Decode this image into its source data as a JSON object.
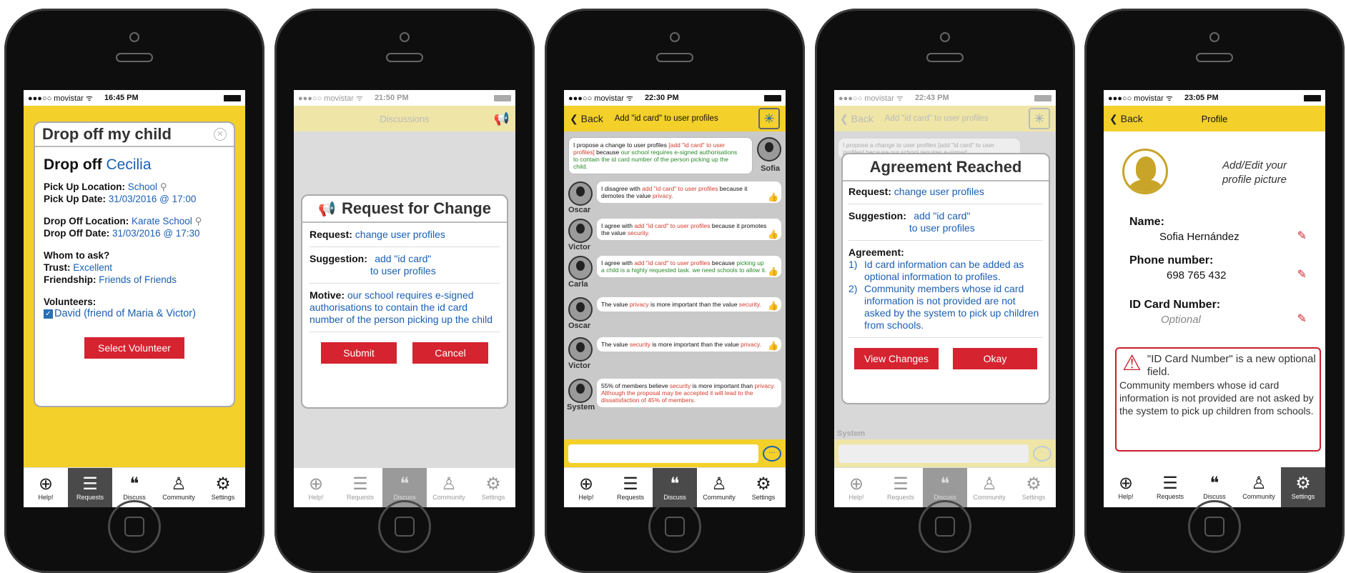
{
  "status": {
    "carrier": "●●●○○ movistar ᯤ",
    "times": [
      "16:45 PM",
      "21:50 PM",
      "22:30 PM",
      "22:43 PM",
      "23:05 PM"
    ]
  },
  "tabs": {
    "help": "Help!",
    "requests": "Requests",
    "discuss": "Discuss",
    "community": "Community",
    "settings": "Settings"
  },
  "screen1": {
    "card_title": "Drop off my child",
    "heading_prefix": "Drop off",
    "heading_name": "Cecilia",
    "pickup_location_label": "Pick Up Location:",
    "pickup_location": "School",
    "pickup_date_label": "Pick Up Date:",
    "pickup_date": "31/03/2016 @ 17:00",
    "dropoff_location_label": "Drop Off Location:",
    "dropoff_location": "Karate School",
    "dropoff_date_label": "Drop Off Date:",
    "dropoff_date": "31/03/2016 @ 17:30",
    "whom_label": "Whom to ask?",
    "trust_label": "Trust:",
    "trust": "Excellent",
    "friendship_label": "Friendship:",
    "friendship": "Friends of Friends",
    "volunteers_label": "Volunteers:",
    "volunteer": "David (friend of  Maria & Victor)",
    "select_button": "Select Volunteer"
  },
  "screen2": {
    "nav_title": "Discussions",
    "card_title": "Request for Change",
    "request_label": "Request:",
    "request": "change user profiles",
    "suggestion_label": "Suggestion:",
    "suggestion_1": "add \"id card\"",
    "suggestion_2": "to user profiles",
    "motive_label": "Motive:",
    "motive": "our school requires e-signed authorisations to contain the id card number of the person picking up the child",
    "submit": "Submit",
    "cancel": "Cancel"
  },
  "screen3": {
    "back": "Back",
    "nav_title": "Add \"id card\" to user profiles",
    "messages": [
      {
        "who": "Sofia",
        "a": "I propose a change to user profiles ",
        "b": "[add \"id card\" to user profiles]",
        "c": " because ",
        "d": "our school requires e-signed authorisations to contain the id card number of the person picking up the child."
      },
      {
        "who": "Oscar",
        "a": "I disagree with ",
        "b": "add \"id card\" to user profiles",
        "c": " because it demotes the value ",
        "d": "privacy."
      },
      {
        "who": "Victor",
        "a": "I agree with ",
        "b": "add \"id card\" to user profiles",
        "c": " because it promotes the value ",
        "d": "security."
      },
      {
        "who": "Carla",
        "a": "I agree with ",
        "b": "add \"id card\" to user profiles",
        "c": " because ",
        "d": "picking up a child is a highly requested task. we need schools to allow it."
      },
      {
        "who": "Oscar",
        "a": "The value ",
        "b": "privacy",
        "c": " is more important than the value ",
        "d": "security."
      },
      {
        "who": "Victor",
        "a": "The value ",
        "b": "security",
        "c": " is more important than the value ",
        "d": "privacy."
      },
      {
        "who": "System",
        "a": "55% of members believe ",
        "b": "security",
        "c": " is more important than ",
        "d": "privacy. Although the proposal may be accepted it will lead to the dissatisfaction of 45% of members."
      }
    ]
  },
  "screen4": {
    "back": "Back",
    "nav_title": "Add \"id card\" to user profiles",
    "card_title": "Agreement Reached",
    "request_label": "Request:",
    "request": "change user profiles",
    "suggestion_label": "Suggestion:",
    "suggestion_1": "add \"id card\"",
    "suggestion_2": "to user profiles",
    "agreement_label": "Agreement:",
    "item1_num": "1)",
    "item1": "Id card information can be added as optional information to profiles.",
    "item2_num": "2)",
    "item2": "Community members whose id card information is not provided are not asked by the system to pick up children from schools.",
    "view_changes": "View Changes",
    "okay": "Okay",
    "bg_text": "I propose a change to user profiles [add \"id card\" to user profiles] because our school requires e-signed",
    "system": "System"
  },
  "screen5": {
    "back": "Back",
    "nav_title": "Profile",
    "picture_label_1": "Add/Edit your",
    "picture_label_2": "profile picture",
    "name_label": "Name:",
    "name": "Sofia Hernández",
    "phone_label": "Phone number:",
    "phone": "698 765 432",
    "id_label": "ID Card Number:",
    "id_placeholder": "Optional",
    "warning_1": "\"ID Card Number\" is a new optional field.",
    "warning_2": "Community members whose id card information is not provided are not asked by the system to pick up children from schools."
  }
}
